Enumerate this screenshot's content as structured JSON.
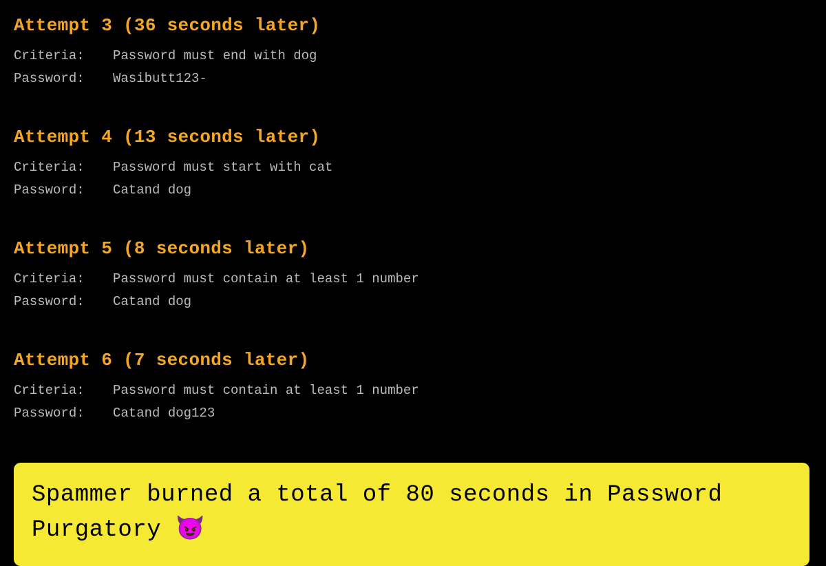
{
  "attempts": [
    {
      "title": "Attempt 3 (36 seconds later)",
      "criteria_label": "Criteria:",
      "criteria_value": "Password must end with dog",
      "password_label": "Password:",
      "password_value": "Wasibutt123-"
    },
    {
      "title": "Attempt 4 (13 seconds later)",
      "criteria_label": "Criteria:",
      "criteria_value": "Password must start with cat",
      "password_label": "Password:",
      "password_value": "Catand dog"
    },
    {
      "title": "Attempt 5 (8 seconds later)",
      "criteria_label": "Criteria:",
      "criteria_value": "Password must contain at least 1 number",
      "password_label": "Password:",
      "password_value": "Catand dog"
    },
    {
      "title": "Attempt 6 (7 seconds later)",
      "criteria_label": "Criteria:",
      "criteria_value": "Password must contain at least 1 number",
      "password_label": "Password:",
      "password_value": "Catand dog123"
    }
  ],
  "summary": "Spammer burned a total of 80 seconds in Password Purgatory 😈"
}
